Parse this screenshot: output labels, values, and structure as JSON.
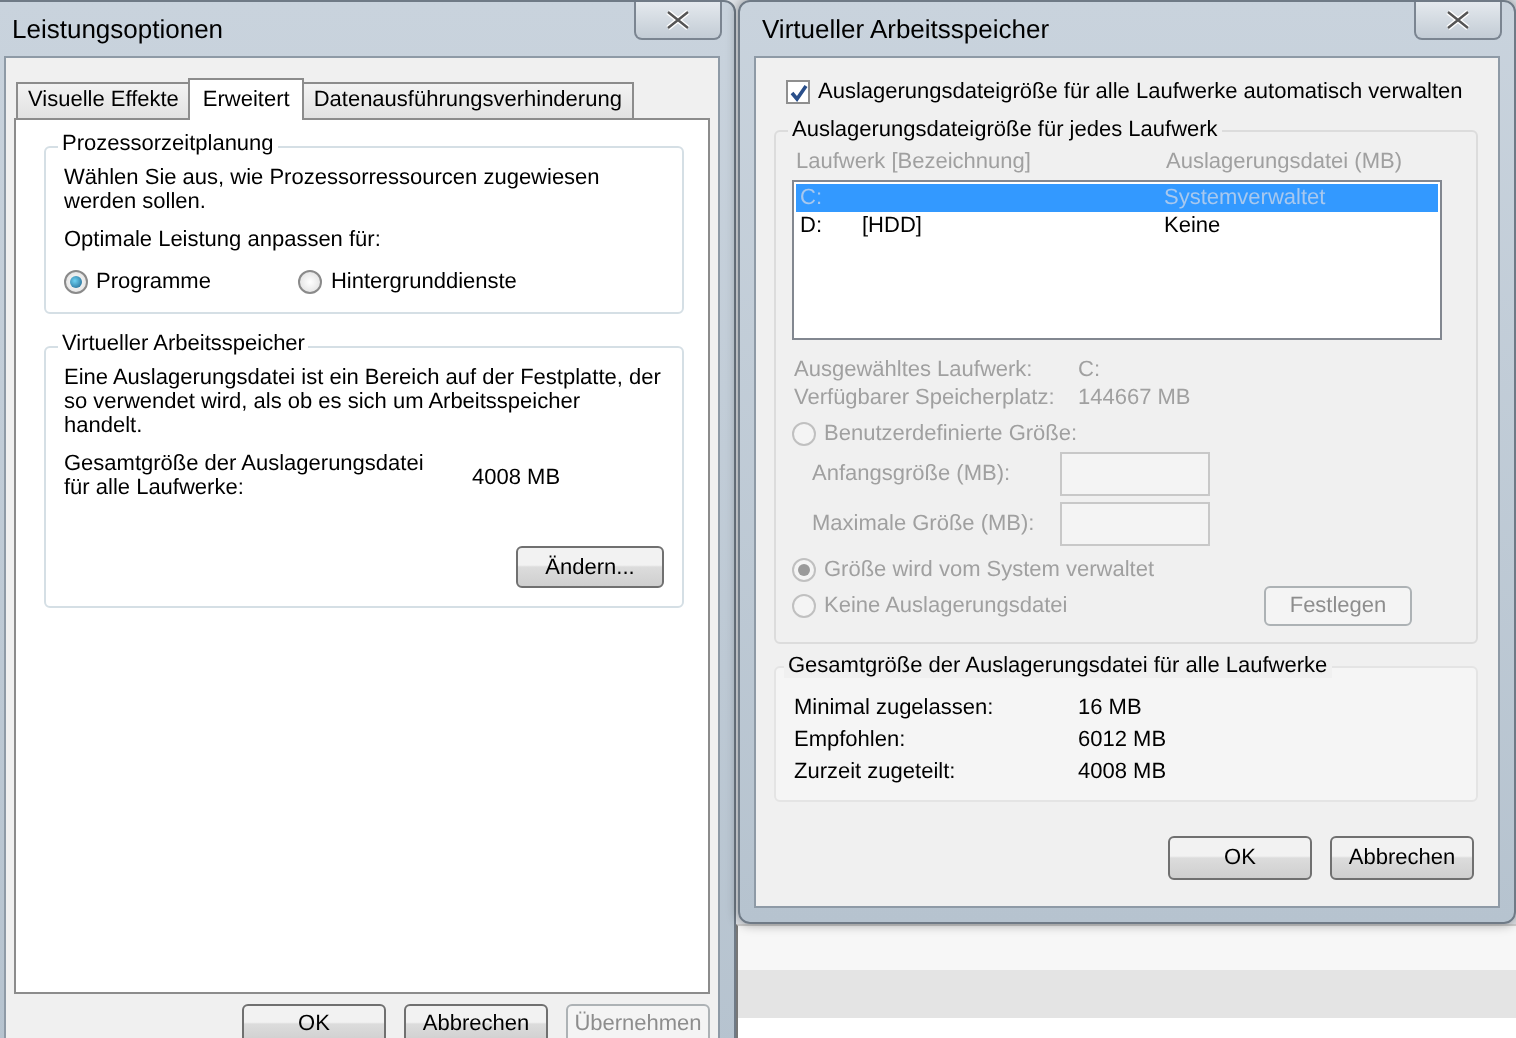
{
  "left_window": {
    "title": "Leistungsoptionen",
    "tabs": [
      {
        "label": "Visuelle Effekte",
        "selected": false
      },
      {
        "label": "Erweitert",
        "selected": true
      },
      {
        "label": "Datenausführungsverhinderung",
        "selected": false
      }
    ],
    "scheduling_group": {
      "title": "Prozessorzeitplanung",
      "description": "Wählen Sie aus, wie Prozessorressourcen zugewiesen werden sollen.",
      "prompt": "Optimale Leistung anpassen für:",
      "options": [
        {
          "label": "Programme",
          "selected": true
        },
        {
          "label": "Hintergrunddienste",
          "selected": false
        }
      ]
    },
    "virtual_memory_group": {
      "title": "Virtueller Arbeitsspeicher",
      "description": "Eine Auslagerungsdatei ist ein Bereich auf der Festplatte, der so verwendet wird, als ob es sich um Arbeitsspeicher handelt.",
      "total_label": "Gesamtgröße der Auslagerungsdatei für alle Laufwerke:",
      "total_value": "4008 MB",
      "change_button": "Ändern..."
    },
    "buttons": [
      {
        "label": "OK",
        "disabled": false
      },
      {
        "label": "Abbrechen",
        "disabled": false
      },
      {
        "label": "Übernehmen",
        "disabled": true
      }
    ]
  },
  "right_window": {
    "title": "Virtueller Arbeitsspeicher",
    "auto_manage": {
      "label": "Auslagerungsdateigröße für alle Laufwerke automatisch verwalten",
      "checked": true
    },
    "drive_group": {
      "title": "Auslagerungsdateigröße für jedes Laufwerk",
      "disabled": true,
      "columns": [
        "Laufwerk [Bezeichnung]",
        "Auslagerungsdatei (MB)"
      ],
      "rows": [
        {
          "drive": "C:",
          "label": "",
          "paging_file": "Systemverwaltet",
          "selected": true
        },
        {
          "drive": "D:",
          "label": "[HDD]",
          "paging_file": "Keine",
          "selected": false
        }
      ],
      "info": [
        {
          "label": "Ausgewähltes Laufwerk:",
          "value": "C:"
        },
        {
          "label": "Verfügbarer Speicherplatz:",
          "value": "144667 MB"
        }
      ],
      "custom_size": {
        "label": "Benutzerdefinierte Größe:",
        "selected": false
      },
      "fields": [
        {
          "label": "Anfangsgröße (MB):"
        },
        {
          "label": "Maximale Größe (MB):"
        }
      ],
      "other_options": [
        {
          "label": "Größe wird vom System verwaltet",
          "selected": true
        },
        {
          "label": "Keine Auslagerungsdatei",
          "selected": false
        }
      ],
      "set_button": "Festlegen"
    },
    "totals_group": {
      "title": "Gesamtgröße der Auslagerungsdatei für alle Laufwerke",
      "rows": [
        {
          "label": "Minimal zugelassen:",
          "value": "16 MB"
        },
        {
          "label": "Empfohlen:",
          "value": "6012 MB"
        },
        {
          "label": "Zurzeit zugeteilt:",
          "value": "4008 MB"
        }
      ]
    },
    "buttons": [
      {
        "label": "OK"
      },
      {
        "label": "Abbrechen"
      }
    ]
  }
}
